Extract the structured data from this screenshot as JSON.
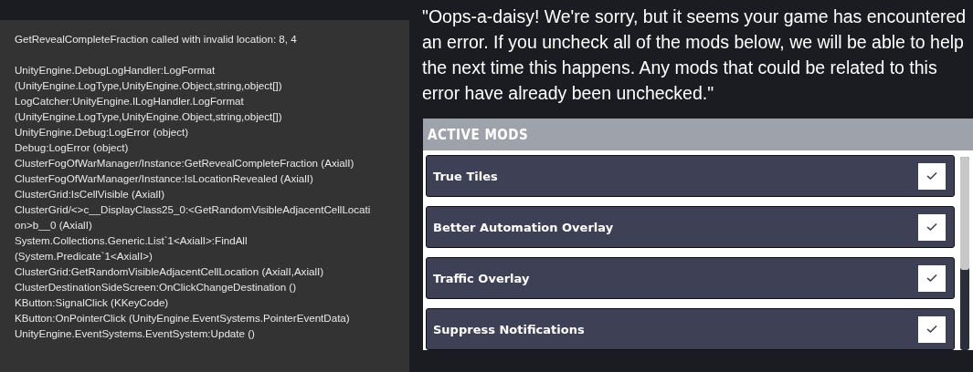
{
  "log": {
    "message": "GetRevealCompleteFraction called with invalid location: 8, 4",
    "stack": [
      "UnityEngine.DebugLogHandler:LogFormat",
      "(UnityEngine.LogType,UnityEngine.Object,string,object[])",
      "LogCatcher:UnityEngine.ILogHandler.LogFormat",
      "(UnityEngine.LogType,UnityEngine.Object,string,object[])",
      "UnityEngine.Debug:LogError (object)",
      "Debug:LogError (object)",
      "ClusterFogOfWarManager/Instance:GetRevealCompleteFraction (AxialI)",
      "ClusterFogOfWarManager/Instance:IsLocationRevealed (AxialI)",
      "ClusterGrid:IsCellVisible (AxialI)",
      "ClusterGrid/<>c__DisplayClass25_0:<GetRandomVisibleAdjacentCellLocati",
      "on>b__0 (AxialI)",
      "System.Collections.Generic.List`1<AxialI>:FindAll",
      "(System.Predicate`1<AxialI>)",
      "ClusterGrid:GetRandomVisibleAdjacentCellLocation (AxialI,AxialI)",
      "ClusterDestinationSideScreen:OnClickChangeDestination ()",
      "KButton:SignalClick (KKeyCode)",
      "KButton:OnPointerClick (UnityEngine.EventSystems.PointerEventData)",
      "UnityEngine.EventSystems.EventSystem:Update ()"
    ]
  },
  "notice": "\"Oops-a-daisy! We're sorry, but it seems your game has encountered an error. If you uncheck all of the mods below, we will be able to help the next time this happens. Any mods that could be related to this error have already been unchecked.\"",
  "mods_panel": {
    "title": "ACTIVE MODS",
    "mods": [
      {
        "name": "True Tiles",
        "checked": true
      },
      {
        "name": "Better Automation Overlay",
        "checked": true
      },
      {
        "name": "Traffic Overlay",
        "checked": true
      },
      {
        "name": "Suppress Notifications",
        "checked": true
      }
    ]
  }
}
